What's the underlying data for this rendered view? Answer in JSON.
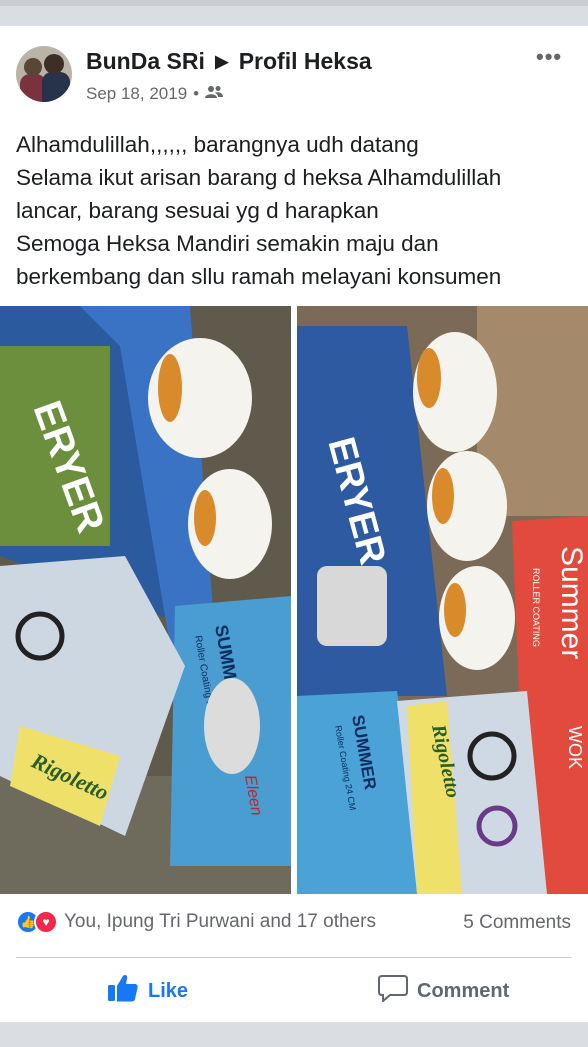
{
  "post": {
    "author": "BunDa SRi",
    "separator_icon": "triangle-right-icon",
    "target_page": "Profil Heksa",
    "date": "Sep 18, 2019",
    "dot": "•",
    "audience_icon": "friends-icon",
    "more_label": "•••",
    "text_lines": [
      "Alhamdulillah,,,,,, barangnya udh datang",
      "Selama ikut arisan barang d heksa Alhamdulillah",
      "lancar,  barang sesuai yg d harapkan",
      "Semoga Heksa Mandiri semakin maju dan",
      "berkembang dan sllu ramah melayani konsumen"
    ]
  },
  "photos": {
    "left": {
      "box_text": "ERYER",
      "brand_text": "Rigoletto",
      "pan_text": "SUMMER",
      "pan_sub": "Roller Coating 24 CM",
      "logo_text": "Eleen"
    },
    "right": {
      "box_text": "ERYER",
      "brand_text": "Rigoletto",
      "pan_text": "SUMMER",
      "pan_sub": "Roller Coating 24 CM",
      "summer_box": "Summer",
      "roller": "ROLLER COATING",
      "wok": "WOK"
    }
  },
  "reactions": {
    "summary": "You, Ipung Tri Purwani and 17 others",
    "comments": "5 Comments"
  },
  "actions": {
    "like": "Like",
    "comment": "Comment"
  },
  "colors": {
    "accent": "#1877f2",
    "love": "#f02849",
    "secondary_text": "#65676b"
  }
}
